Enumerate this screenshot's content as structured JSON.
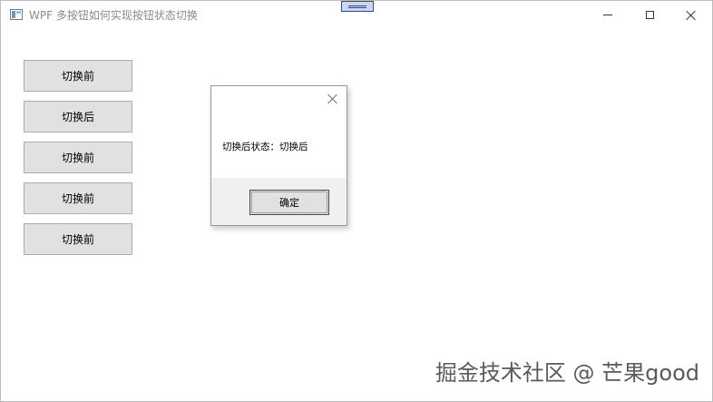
{
  "window": {
    "title": "WPF 多按钮如何实现按钮状态切换"
  },
  "buttons": [
    {
      "label": "切换前"
    },
    {
      "label": "切换后"
    },
    {
      "label": "切换前"
    },
    {
      "label": "切换前"
    },
    {
      "label": "切换前"
    }
  ],
  "dialog": {
    "message": "切换后状态：切换后",
    "ok_label": "确定"
  },
  "watermark": "掘金技术社区 @ 芒果good",
  "icons": {
    "app": "app-window-icon",
    "minimize": "minimize-icon",
    "maximize": "maximize-icon",
    "close": "close-icon",
    "drag": "drag-handle-icon"
  },
  "colors": {
    "button_bg": "#e1e1e1",
    "dialog_footer": "#f0f0f0",
    "title_text": "#8a8a8a"
  }
}
